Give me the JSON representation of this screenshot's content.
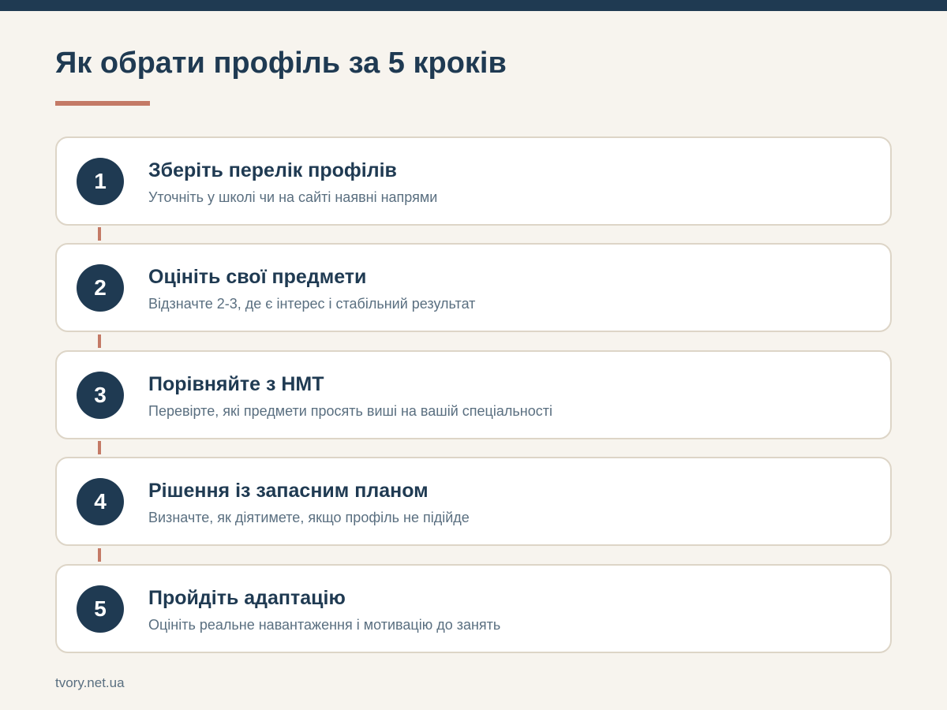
{
  "title": "Як обрати профіль за 5 кроків",
  "colors": {
    "header_bar": "#1f3a52",
    "accent": "#c47a66",
    "badge": "#1f3a52",
    "background": "#f7f4ee"
  },
  "steps": [
    {
      "number": "1",
      "title": "Зберіть перелік профілів",
      "description": "Уточніть у школі чи на сайті наявні напрями"
    },
    {
      "number": "2",
      "title": "Оцініть свої предмети",
      "description": "Відзначте 2-3, де є інтерес і стабільний результат"
    },
    {
      "number": "3",
      "title": "Порівняйте з НМТ",
      "description": "Перевірте, які предмети просять виші на вашій спеціальності"
    },
    {
      "number": "4",
      "title": "Рішення із запасним планом",
      "description": "Визначте, як діятимете, якщо профіль не підійде"
    },
    {
      "number": "5",
      "title": "Пройдіть адаптацію",
      "description": "Оцініть реальне навантаження і мотивацію до занять"
    }
  ],
  "footer": "tvory.net.ua"
}
